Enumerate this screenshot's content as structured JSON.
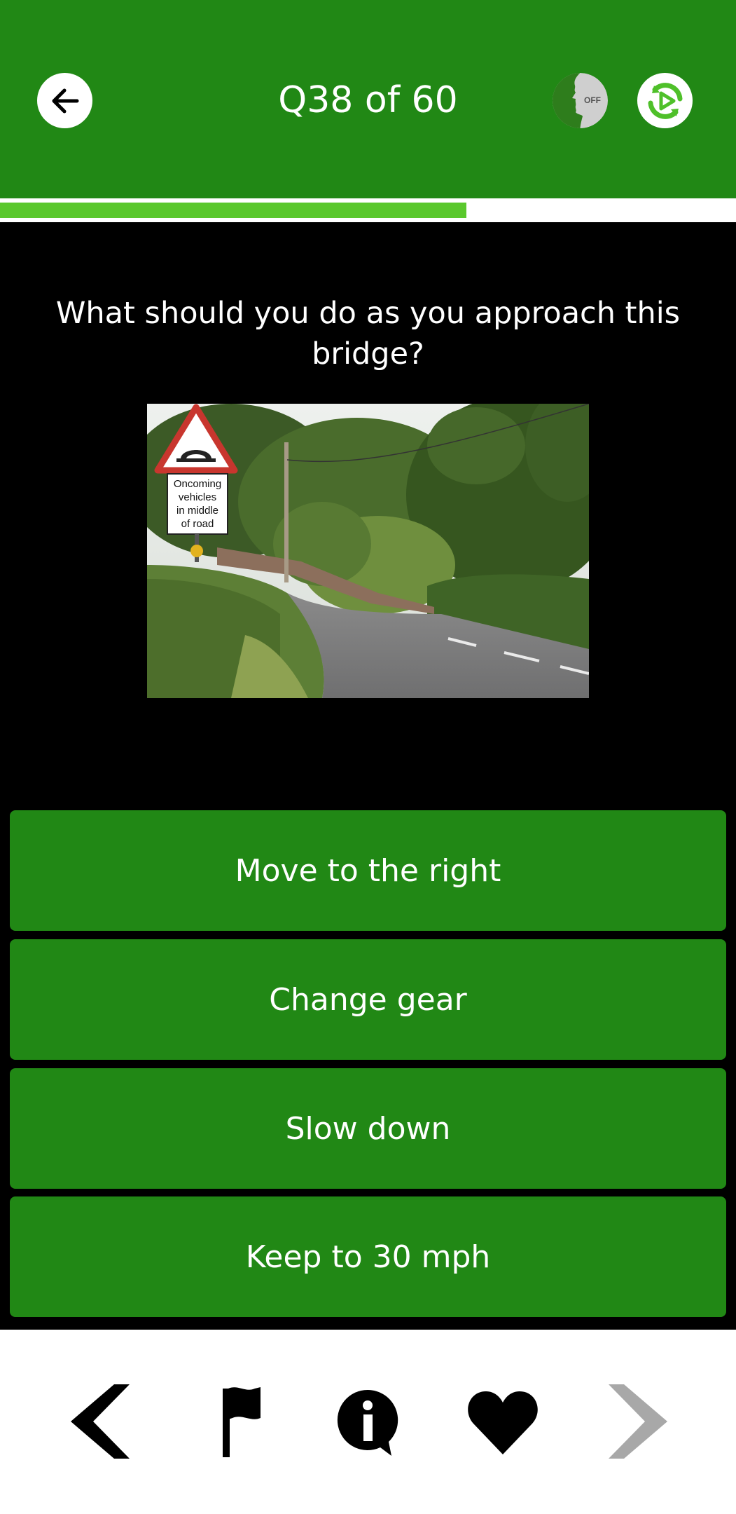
{
  "header": {
    "title": "Q38 of 60",
    "voice_toggle_label": "OFF",
    "accent_color": "#218815"
  },
  "progress": {
    "value": 38,
    "max": 60,
    "fill_color": "#5ac82d"
  },
  "question": {
    "text": "What should you do as you approach this bridge?",
    "image": {
      "sign_text": [
        "Oncoming",
        "vehicles",
        "in middle",
        "of road"
      ]
    }
  },
  "answers": [
    {
      "label": "Move to the right"
    },
    {
      "label": "Change gear"
    },
    {
      "label": "Slow down"
    },
    {
      "label": "Keep to 30 mph"
    }
  ],
  "bottom_nav": {
    "icons": [
      "previous-icon",
      "flag-icon",
      "info-icon",
      "heart-icon",
      "next-icon"
    ]
  }
}
